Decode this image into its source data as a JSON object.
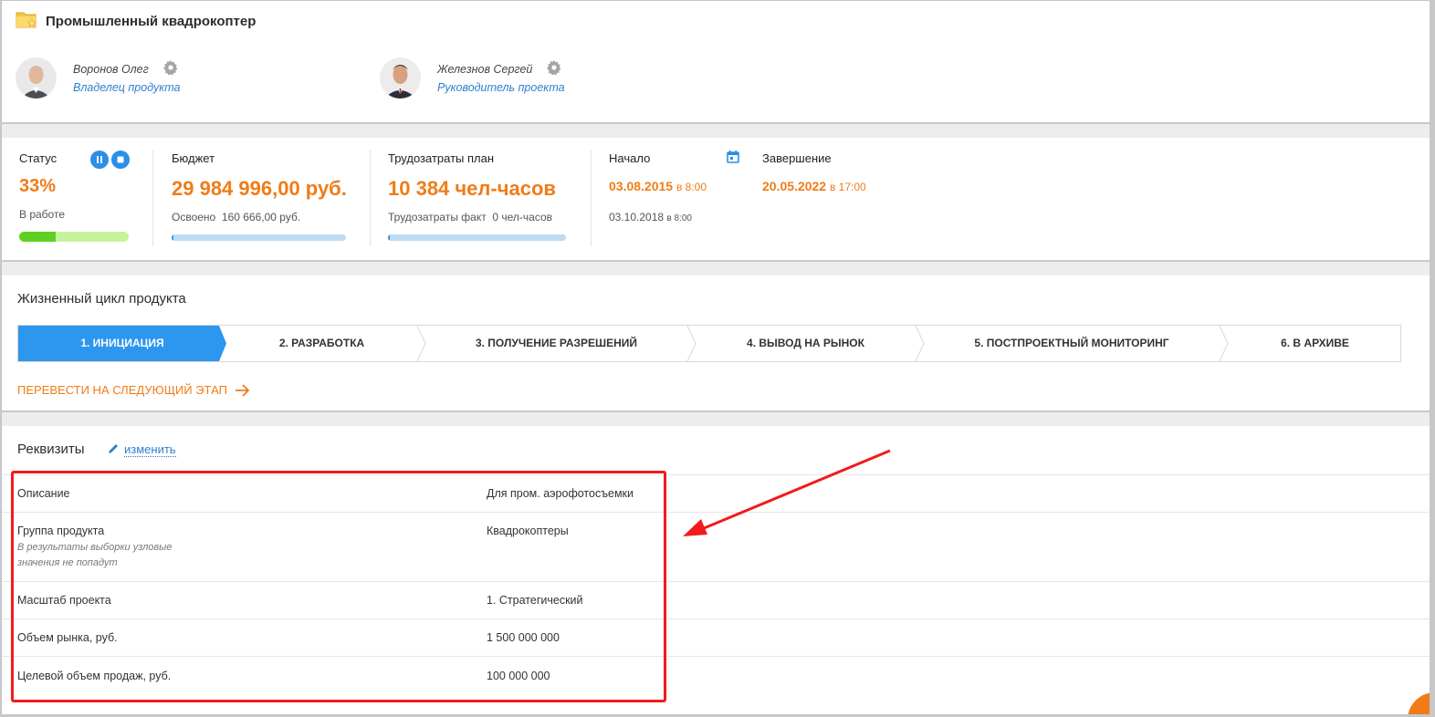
{
  "project": {
    "title": "Промышленный квадрокоптер"
  },
  "people": [
    {
      "name": "Воронов Олег",
      "role": "Владелец продукта"
    },
    {
      "name": "Железнов Сергей",
      "role": "Руководитель проекта"
    }
  ],
  "status": {
    "label": "Статус",
    "percent": "33%",
    "state": "В работе",
    "progress": 0.33
  },
  "budget": {
    "label": "Бюджет",
    "value": "29 984 996,00 руб.",
    "spent_label": "Освоено",
    "spent_value": "160 666,00 руб.",
    "progress": 0.005
  },
  "labor": {
    "label": "Трудозатраты план",
    "value": "10 384 чел-часов",
    "fact_label": "Трудозатраты факт",
    "fact_value": "0 чел-часов",
    "progress": 0.004
  },
  "start": {
    "label": "Начало",
    "date": "03.08.2015",
    "time": "в 8:00",
    "actual_date": "03.10.2018",
    "actual_time": "в 8:00"
  },
  "end": {
    "label": "Завершение",
    "date": "20.05.2022",
    "time": "в 17:00"
  },
  "lifecycle": {
    "title": "Жизненный цикл продукта",
    "stages": [
      "1. ИНИЦИАЦИЯ",
      "2. РАЗРАБОТКА",
      "3. ПОЛУЧЕНИЕ РАЗРЕШЕНИЙ",
      "4. ВЫВОД НА РЫНОК",
      "5. ПОСТПРОЕКТНЫЙ МОНИТОРИНГ",
      "6. В АРХИВЕ"
    ],
    "active_index": 0,
    "next_label": "ПЕРЕВЕСТИ НА СЛЕДУЮЩИЙ ЭТАП"
  },
  "requisites": {
    "title": "Реквизиты",
    "edit_label": "изменить",
    "rows": [
      {
        "key": "Описание",
        "value": "Для пром. аэрофотосъемки"
      },
      {
        "key": "Группа продукта",
        "note": "В результаты выборки узловые значения не попадут",
        "value": "Квадрокоптеры"
      },
      {
        "key": "Масштаб проекта",
        "value": "1. Стратегический"
      },
      {
        "key": "Объем рынка, руб.",
        "value": "1 500 000 000"
      },
      {
        "key": "Целевой объем продаж, руб.",
        "value": "100 000 000"
      }
    ]
  },
  "colors": {
    "accent": "#f07c17",
    "link": "#2f7fcf",
    "primary": "#2d8ee6",
    "highlight": "#f21b1b"
  },
  "icons": {
    "folder": "folder-star-icon",
    "gear": "gear-icon",
    "pause": "pause-icon",
    "stop": "stop-icon",
    "calendar": "calendar-icon",
    "pencil": "pencil-icon",
    "arrow": "arrow-right-icon"
  }
}
